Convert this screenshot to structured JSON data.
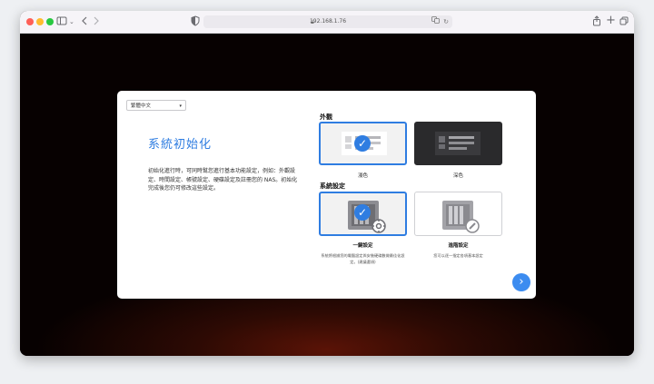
{
  "browser": {
    "url": "192.168.1.76",
    "icons": {
      "sidebar": "sidebar-icon",
      "back": "chevron-left-icon",
      "forward": "chevron-right-icon",
      "shield": "shield-icon",
      "lock": "lock-icon",
      "translate": "translate-icon",
      "reload": "reload-icon",
      "share": "share-icon",
      "new_tab": "plus-icon",
      "tabs": "tabs-icon"
    }
  },
  "setup": {
    "language": "繁體中文",
    "title": "系統初始化",
    "description": "初始化進行時，可同時幫您進行基本功能設定，例如：外觀設定、時間設定、帳號設定、硬碟設定及註冊您的 NAS。初始化完成後您仍可修改這些設定。",
    "appearance": {
      "heading": "外觀",
      "options": [
        {
          "label": "淺色",
          "selected": true
        },
        {
          "label": "深色",
          "selected": false
        }
      ]
    },
    "system_settings": {
      "heading": "系統設定",
      "options": [
        {
          "label": "一鍵設定",
          "description": "系統將根據您的電腦設定與安裝硬碟數做最佳化設定。(建議選項)",
          "selected": true
        },
        {
          "label": "進階設定",
          "description": "您可以逐一指定各項基本設定",
          "selected": false
        }
      ]
    }
  },
  "colors": {
    "accent": "#2f7de1",
    "next_button": "#3c8cf0"
  }
}
